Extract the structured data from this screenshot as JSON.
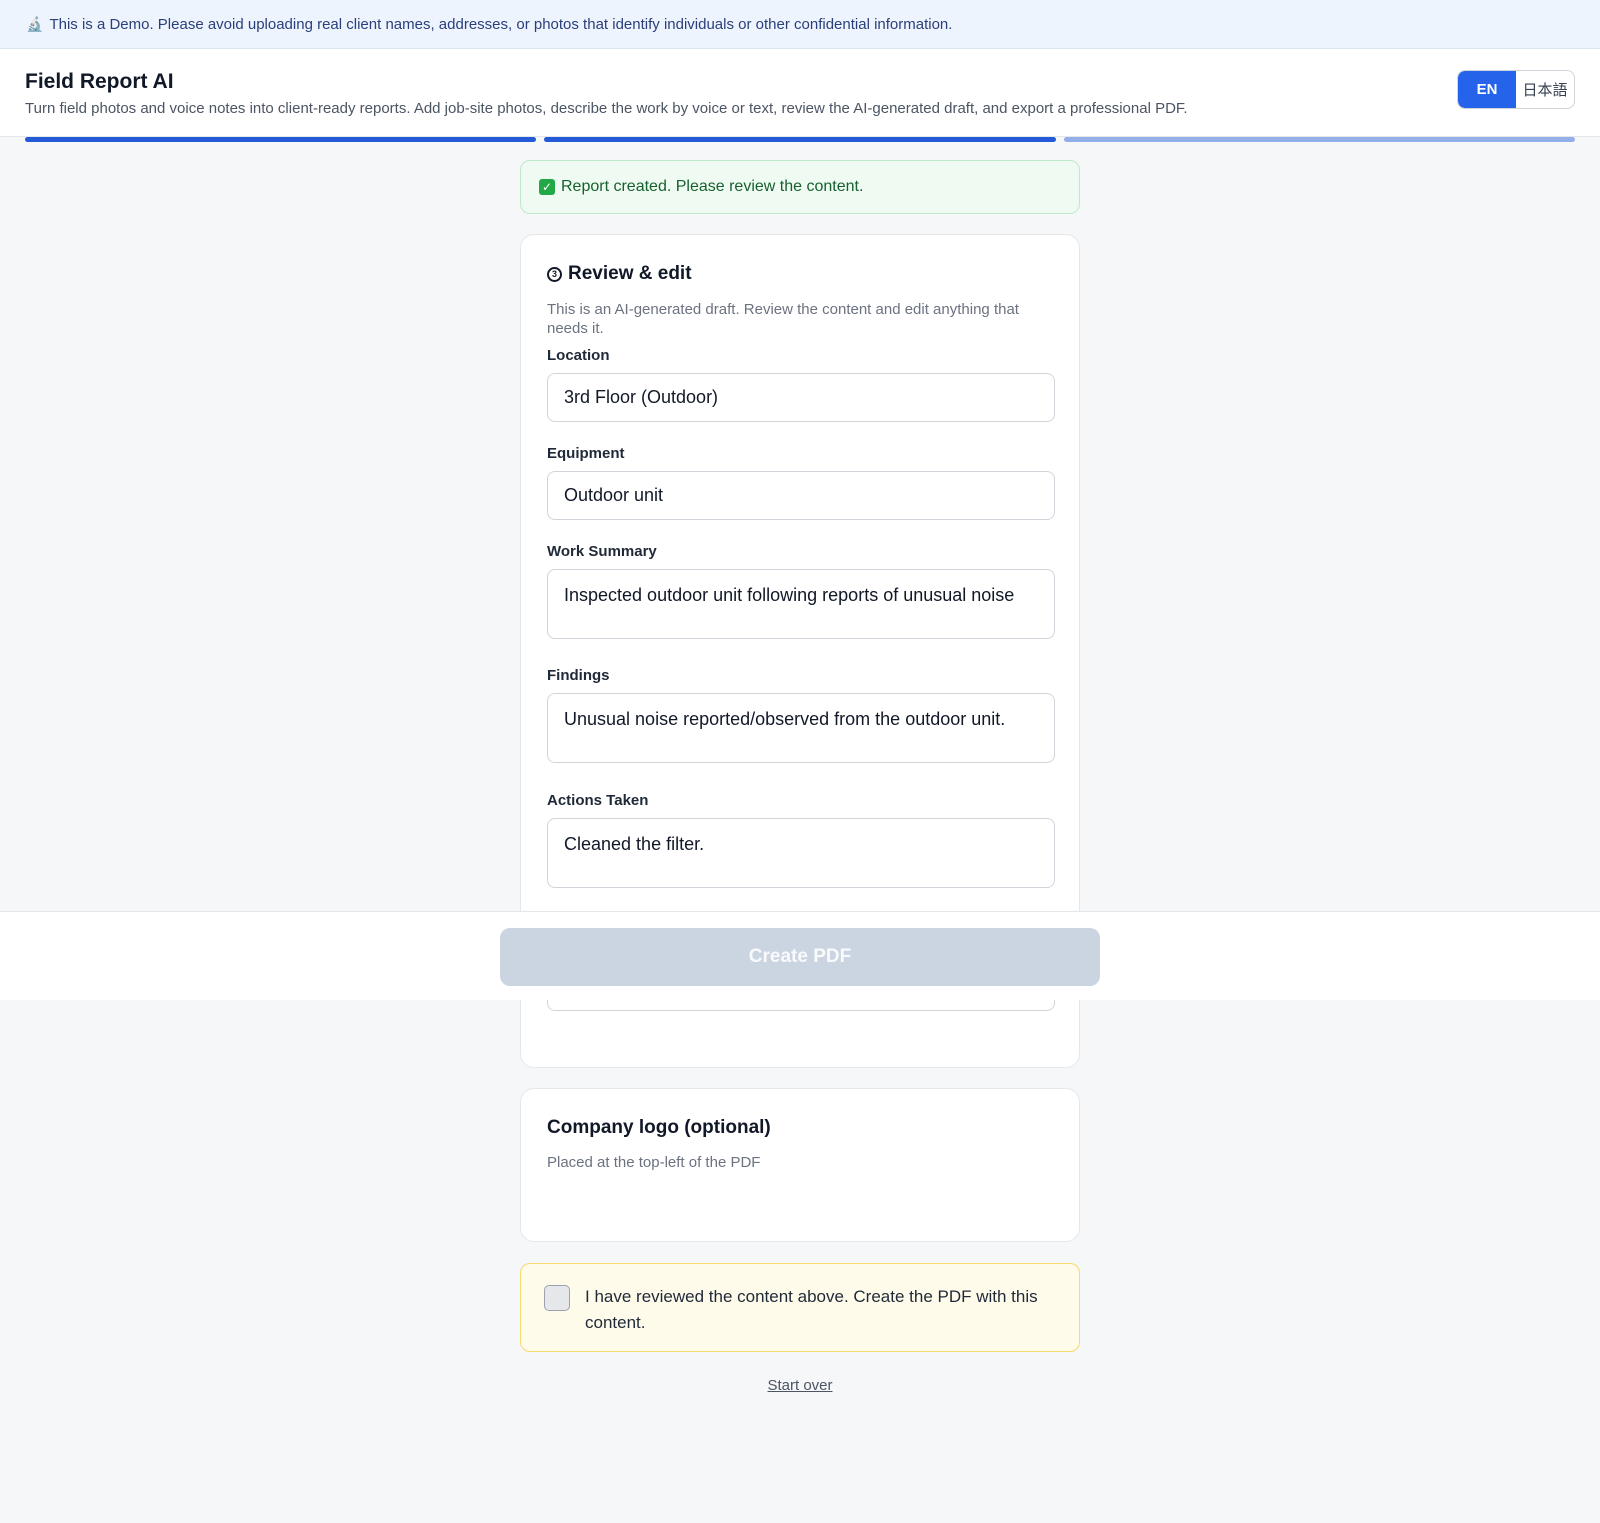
{
  "banner": {
    "icon": "microscope-icon",
    "text": "This is a Demo. Please avoid uploading real client names, addresses, or photos that identify individuals or other confidential information."
  },
  "header": {
    "title": "Field Report AI",
    "subtitle": "Turn field photos and voice notes into client-ready reports. Add job-site photos, describe the work by voice or text, review the AI-generated draft, and export a professional PDF."
  },
  "language": {
    "options": [
      "EN",
      "日本語"
    ],
    "selected": "EN"
  },
  "progress": {
    "steps_total": 3,
    "steps_completed": 2
  },
  "alert": {
    "icon": "check-icon",
    "text": "Report created. Please review the content."
  },
  "review": {
    "step_icon": "circled-3-icon",
    "title": "Review & edit",
    "description": "This is an AI-generated draft. Review the content and edit anything that needs it.",
    "fields": {
      "location": {
        "label": "Location",
        "value": "3rd Floor (Outdoor)"
      },
      "equipment": {
        "label": "Equipment",
        "value": "Outdoor unit"
      },
      "work_summary": {
        "label": "Work Summary",
        "value": "Inspected outdoor unit following reports of unusual noise"
      },
      "findings": {
        "label": "Findings",
        "value": "Unusual noise reported/observed from the outdoor unit."
      },
      "actions_taken": {
        "label": "Actions Taken",
        "value": "Cleaned the filter."
      }
    }
  },
  "actions": {
    "create_pdf": "Create PDF",
    "create_pdf_enabled": false
  },
  "logo": {
    "title": "Company logo (optional)",
    "description": "Placed at the top-left of the PDF"
  },
  "confirm": {
    "checked": false,
    "text": "I have reviewed the content above. Create the PDF with this content."
  },
  "footer": {
    "start_over": "Start over"
  },
  "colors": {
    "accent": "#2563eb",
    "progress_done": "#2459d8",
    "progress_pending": "#93afe9",
    "success_bg": "#effbf2",
    "warning_bg": "#fffbeb",
    "disabled_button": "#cbd5e1"
  }
}
